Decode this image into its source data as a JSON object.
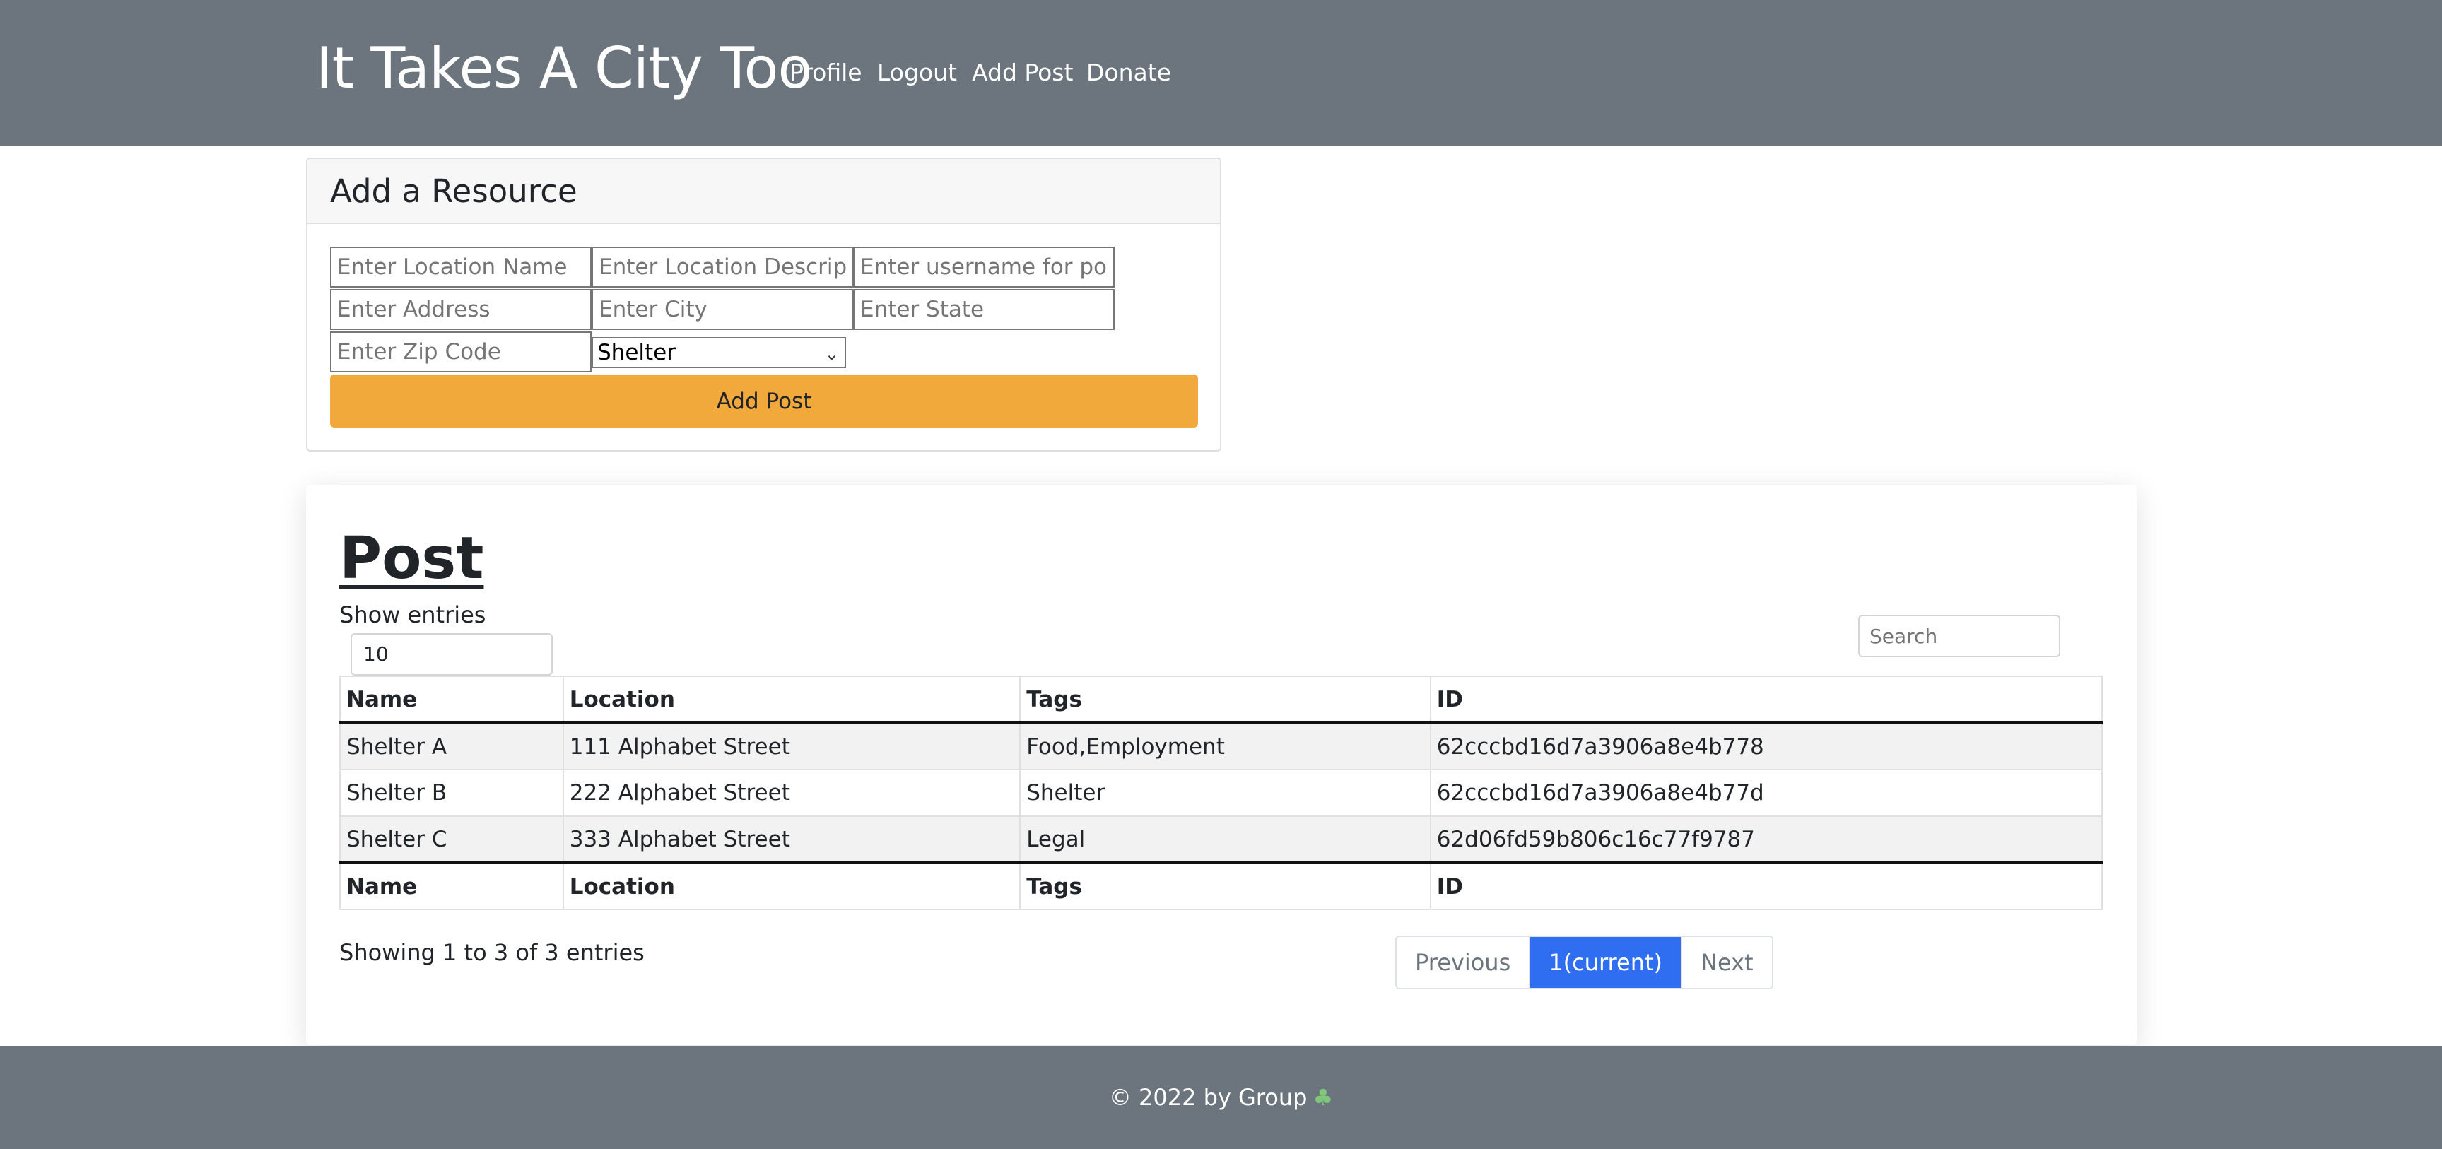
{
  "navbar": {
    "brand": "It Takes A City Too",
    "links": [
      "Profile",
      "Logout",
      "Add Post",
      "Donate"
    ]
  },
  "add_resource": {
    "title": "Add a Resource",
    "placeholders": {
      "location_name": "Enter Location Name",
      "location_description": "Enter Location Description",
      "username": "Enter username for post",
      "address": "Enter Address",
      "city": "Enter City",
      "state": "Enter State",
      "zip": "Enter Zip Code"
    },
    "category_selected": "Shelter",
    "submit_label": "Add Post"
  },
  "posts": {
    "title": "Post",
    "show_entries_label": "Show entries",
    "entries_value": "10",
    "search_placeholder": "Search",
    "columns": [
      "Name",
      "Location",
      "Tags",
      "ID"
    ],
    "rows": [
      [
        "Shelter A",
        "111 Alphabet Street",
        "Food,Employment",
        "62cccbd16d7a3906a8e4b778"
      ],
      [
        "Shelter B",
        "222 Alphabet Street",
        "Shelter",
        "62cccbd16d7a3906a8e4b77d"
      ],
      [
        "Shelter C",
        "333 Alphabet Street",
        "Legal",
        "62d06fd59b806c16c77f9787"
      ]
    ],
    "info": "Showing 1 to 3 of 3 entries",
    "pagination": {
      "previous": "Previous",
      "current": "1(current)",
      "next": "Next"
    }
  },
  "footer": {
    "text": "© 2022 by Group",
    "icon": "clover-icon",
    "icon_color": "#7fc87a"
  },
  "colors": {
    "navbar_bg": "#6c757d",
    "add_button": "#f1a93b",
    "pager_active": "#2f6ef0"
  }
}
